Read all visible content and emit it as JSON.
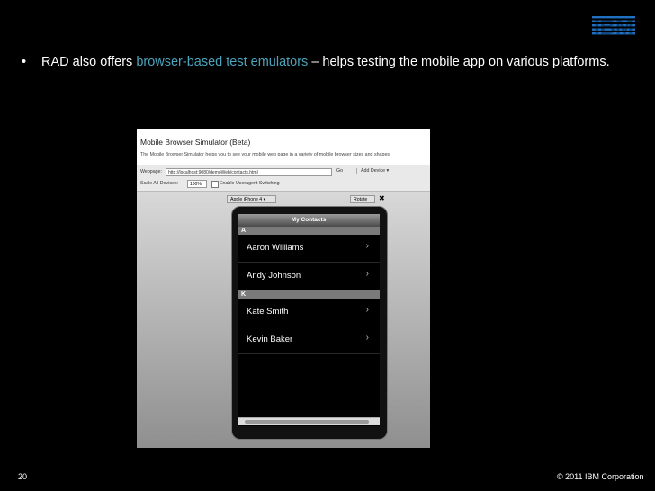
{
  "logo": "IBM",
  "bullet": {
    "marker": "•",
    "part1": "RAD also offers ",
    "highlight": "browser-based test emulators",
    "part2": " – helps testing the mobile app on various platforms."
  },
  "simulator": {
    "title": "Mobile Browser Simulator (Beta)",
    "description": "The Mobile Browser Simulator helps you to see your mobile web page in a variety of mobile browser sizes and shapes.",
    "webpage_label": "Webpage:",
    "url": "http://localhost:9080/demoWeb/contacts.html",
    "go_label": "Go",
    "add_device_label": "Add Device ▾",
    "scale_label": "Scale All Devices:",
    "scale_value": "100%",
    "ua_label": "Enable Useragent Switching",
    "device_select": "Apple iPhone 4 ▾",
    "rotate_label": "Rotate",
    "close_label": "✖"
  },
  "phone": {
    "header": "My Contacts",
    "sections": [
      {
        "letter": "A",
        "contacts": [
          "Aaron Williams",
          "Andy Johnson"
        ]
      },
      {
        "letter": "K",
        "contacts": [
          "Kate Smith",
          "Kevin Baker"
        ]
      }
    ]
  },
  "footer": {
    "page_number": "20",
    "copyright": "© 2011 IBM Corporation"
  },
  "colors": {
    "background": "#000000",
    "highlight": "#4aa3bc"
  }
}
